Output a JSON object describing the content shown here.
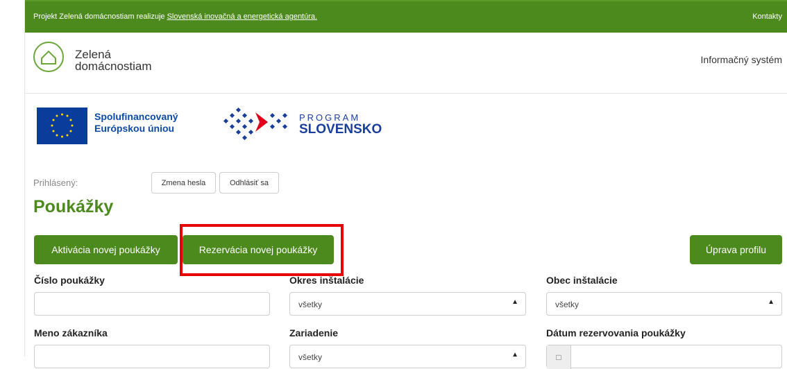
{
  "topbar": {
    "notice_prefix": "Projekt Zelená domácnostiam realizuje ",
    "notice_link": "Slovenská inovačná a energetická agentúra.",
    "contacts": "Kontakty"
  },
  "header": {
    "logo_line1": "Zelená",
    "logo_line2": "domácnostiam",
    "info_system": "Informačný systém"
  },
  "funding": {
    "eu_line1": "Spolufinancovaný",
    "eu_line2": "Európskou úniou",
    "program_small": "PROGRAM",
    "program_big": "SLOVENSKO"
  },
  "user": {
    "logged_in_label": "Prihlásený:",
    "change_password": "Zmena hesla",
    "logout": "Odhlásiť sa"
  },
  "page": {
    "title": "Poukážky"
  },
  "actions": {
    "activate": "Aktivácia novej poukážky",
    "reserve": "Rezervácia novej poukážky",
    "edit_profile": "Úprava profilu"
  },
  "filters": {
    "voucher_number": "Číslo poukážky",
    "district": "Okres inštalácie",
    "district_value": "všetky",
    "municipality": "Obec inštalácie",
    "municipality_value": "všetky",
    "customer_name": "Meno zákazníka",
    "device": "Zariadenie",
    "device_value": "všetky",
    "reservation_date": "Dátum rezervovania poukážky"
  },
  "colors": {
    "brand_green": "#4d8a1e",
    "highlight_red": "#e60000",
    "eu_blue": "#0a3d9b"
  }
}
